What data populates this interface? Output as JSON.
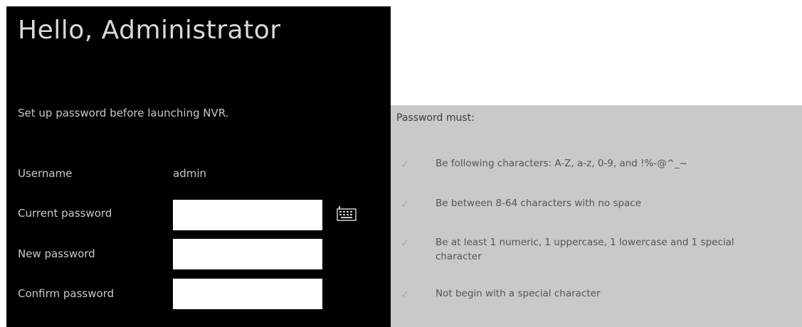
{
  "greeting": "Hello, Administrator",
  "subtitle": "Set up password before launching NVR.",
  "form": {
    "username_label": "Username",
    "username_value": "admin",
    "current_password_label": "Current password",
    "new_password_label": "New password",
    "confirm_password_label": "Confirm password",
    "current_password_value": "",
    "new_password_value": "",
    "confirm_password_value": "",
    "keyboard_icon": "keyboard-icon"
  },
  "requirements": {
    "header": "Password must:",
    "items": [
      {
        "text": "Be following characters: A-Z, a-z, 0-9, and !%-@^_~",
        "icon": "check-icon"
      },
      {
        "text": "Be between 8-64 characters with no space",
        "icon": "check-icon"
      },
      {
        "text": "Be at least 1 numeric, 1 uppercase, 1 lowercase and 1 special character",
        "icon": "check-icon"
      },
      {
        "text": "Not begin with a special character",
        "icon": "check-icon"
      }
    ]
  },
  "colors": {
    "left_panel_bg": "#000000",
    "right_panel_bg": "#c9c9c9",
    "input_bg": "#ffffff"
  }
}
